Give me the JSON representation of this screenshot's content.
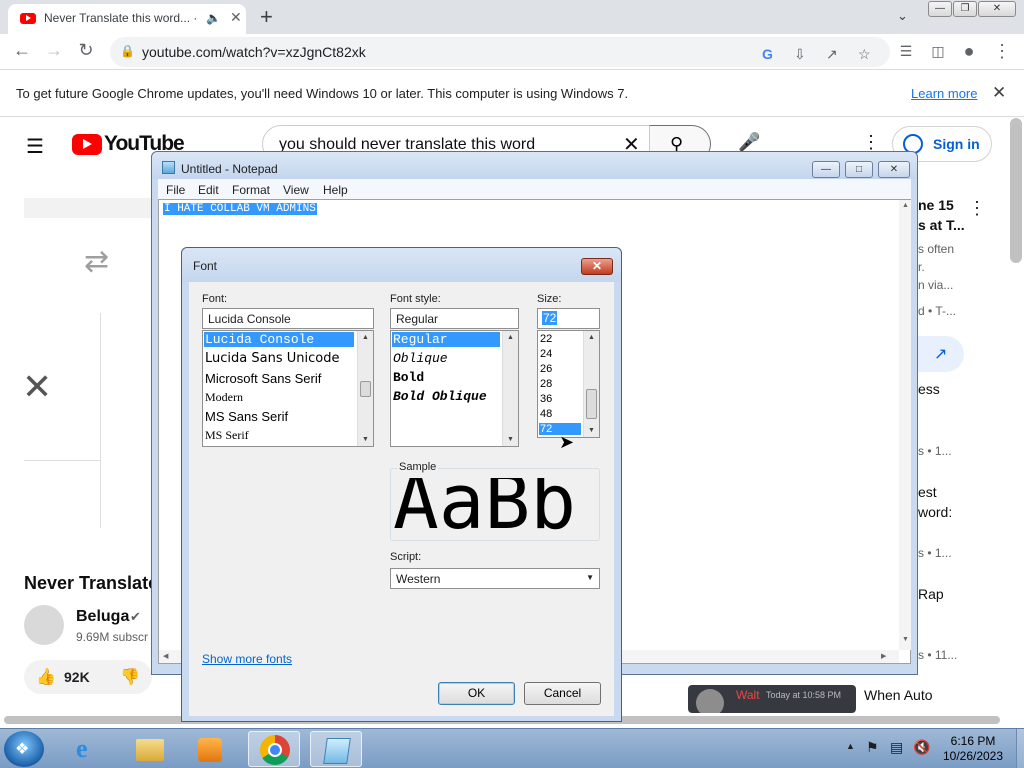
{
  "browser": {
    "tab_title": "Never Translate this word... ·",
    "url": "youtube.com/watch?v=xzJgnCt82xk",
    "infobar_message": "To get future Google Chrome updates, you'll need Windows 10 or later. This computer is using Windows 7.",
    "infobar_link": "Learn more"
  },
  "youtube": {
    "logo_text": "YouTube",
    "search_query": "you should never translate this word",
    "signin_label": "Sign in",
    "video_title_partial": "Never Translate",
    "channel_name": "Beluga",
    "subscribers_partial": "9.69M subscr",
    "likes": "92K",
    "sidebar": {
      "t1a": "ne 15",
      "t1b": "s at T...",
      "t1c": "s often",
      "t1d": "r.",
      "t1e": "n via...",
      "t1f": "d • T-...",
      "t2": "ess",
      "t3a": "s • 1...",
      "t4a": "est",
      "t4b": "word:",
      "t5a": "s • 1...",
      "t6": "Rap",
      "t7": "s • 11...",
      "t8": "When Auto",
      "thumb_name": "Walt",
      "thumb_time": "Today at 10:58 PM"
    }
  },
  "notepad": {
    "title": "Untitled - Notepad",
    "menus": [
      "File",
      "Edit",
      "Format",
      "View",
      "Help"
    ],
    "text": "I HATE COLLAB VM ADMINS"
  },
  "font_dialog": {
    "title": "Font",
    "font_label": "Font:",
    "font_value": "Lucida Console",
    "fonts": [
      "Lucida Console",
      "Lucida Sans Unicode",
      "Microsoft Sans Serif",
      "Modern",
      "MS Sans Serif",
      "MS Serif"
    ],
    "style_label": "Font style:",
    "style_value": "Regular",
    "styles": [
      "Regular",
      "Oblique",
      "Bold",
      "Bold Oblique"
    ],
    "size_label": "Size:",
    "size_value": "72",
    "sizes": [
      "22",
      "24",
      "26",
      "28",
      "36",
      "48",
      "72"
    ],
    "sample_label": "Sample",
    "sample_text": "AaBb",
    "script_label": "Script:",
    "script_value": "Western",
    "show_more": "Show more fonts",
    "ok_label": "OK",
    "cancel_label": "Cancel"
  },
  "taskbar": {
    "time": "6:16 PM",
    "date": "10/26/2023"
  },
  "colors": {
    "youtube_red": "#ff0000",
    "selection_blue": "#3399ff",
    "link_blue": "#1a73e8",
    "signin_blue": "#065fd4"
  }
}
